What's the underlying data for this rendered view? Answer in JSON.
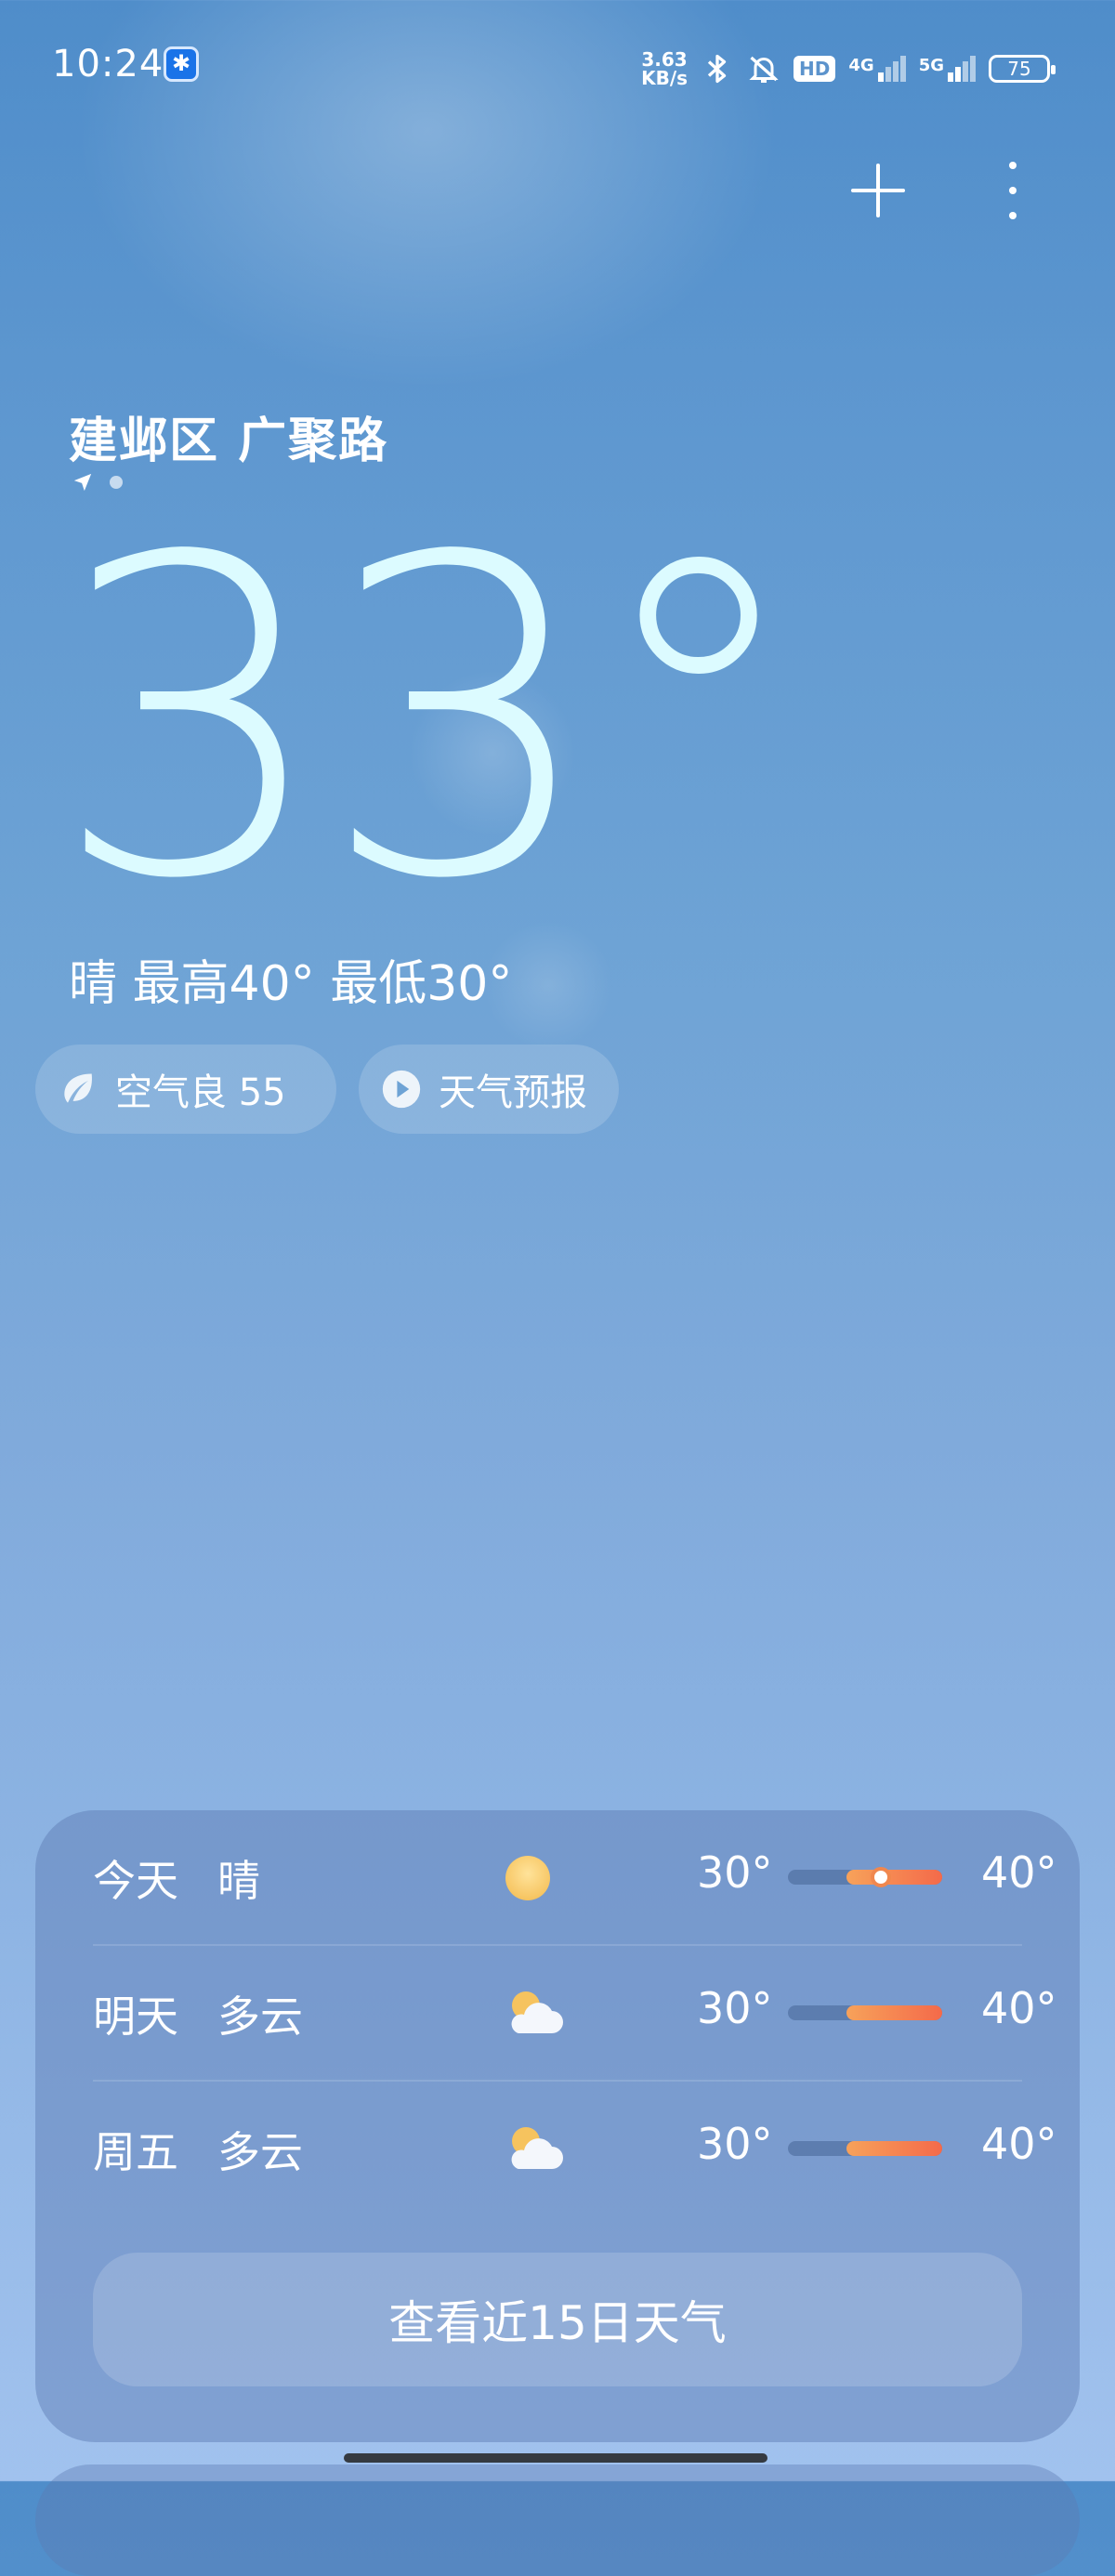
{
  "status_bar": {
    "time": "10:24",
    "net_speed": "3.63\nKB/s",
    "hd_label": "HD",
    "network_1": "4G",
    "network_2": "5G",
    "battery": "75"
  },
  "location": {
    "name": "建邺区 广聚路"
  },
  "current": {
    "temperature": "33°",
    "summary": "晴  最高40° 最低30°"
  },
  "chips": {
    "air_quality": "空气良 55",
    "forecast_video": "天气预报"
  },
  "forecast": {
    "rows": [
      {
        "day": "今天",
        "condition": "晴",
        "icon": "sun-icon",
        "low": "30°",
        "high": "40°",
        "range_start": 0.38,
        "range_end": 1.0,
        "current": 0.6
      },
      {
        "day": "明天",
        "condition": "多云",
        "icon": "partly-cloudy-icon",
        "low": "30°",
        "high": "40°",
        "range_start": 0.38,
        "range_end": 1.0
      },
      {
        "day": "周五",
        "condition": "多云",
        "icon": "partly-cloudy-icon",
        "low": "30°",
        "high": "40°",
        "range_start": 0.38,
        "range_end": 1.0
      }
    ],
    "more_button": "查看近15日天气"
  },
  "colors": {
    "temperature": "#dcfbff",
    "range_warm": "#f46a4a",
    "range_mild": "#f7a25a"
  }
}
